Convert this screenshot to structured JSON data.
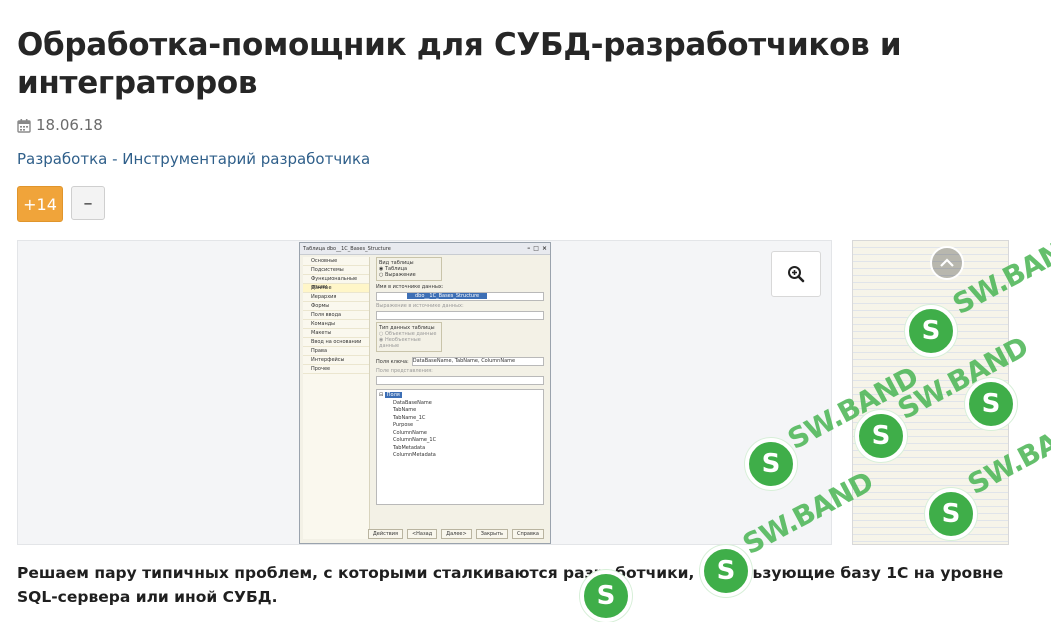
{
  "article": {
    "title": "Обработка-помощник для СУБД-разработчиков и интеграторов",
    "date": "18.06.18",
    "breadcrumb": "Разработка - Инструментарий разработчика",
    "rating_plus": "+14",
    "rating_minus": "–",
    "description": "Решаем пару типичных проблем, с которыми сталкиваются разработчики, использующие базу 1С на уровне SQL-сервера или иной СУБД."
  },
  "screenshot": {
    "window_title": "Таблица dbo__1C_Bases_Structure",
    "sidebar": [
      "Основные",
      "Подсистемы",
      "Функциональные опции",
      "Данные",
      "Иерархия",
      "Формы",
      "Поля ввода",
      "Команды",
      "Макеты",
      "Ввод на основании",
      "Права",
      "Интерфейсы",
      "Прочее"
    ],
    "group_type_label": "Вид таблицы",
    "radio_table": "Таблица",
    "radio_expression": "Выражение",
    "source_name_label": "Имя в источнике данных:",
    "source_name_value": "dbo__1C_Bases_Structure",
    "expression_label": "Выражение в источнике данных:",
    "data_type_label": "Тип данных таблицы",
    "data_type_objects": "Объектные данные",
    "data_type_nonobject": "Необъектные данные",
    "key_fields_label": "Поля ключа:",
    "key_fields_value": "DataBaseName, TabName, ColumnName",
    "view_field_label": "Поле представления:",
    "tree_root": "Поля",
    "tree_items": [
      "DataBaseName",
      "TabName",
      "TabName_1C",
      "Purpose",
      "ColumnName",
      "ColumnName_1C",
      "TabMetadata",
      "ColumnMetadata"
    ],
    "buttons": [
      "Действия",
      "<Назад",
      "Далее>",
      "Закрыть",
      "Справка"
    ]
  },
  "watermark": "SW.BAND"
}
